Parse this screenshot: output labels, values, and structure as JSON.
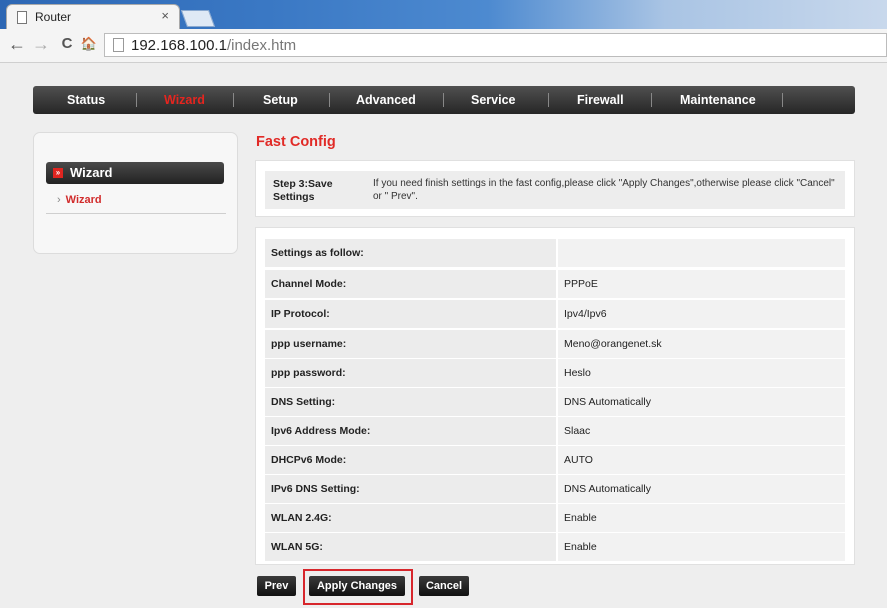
{
  "browser": {
    "tab_title": "Router",
    "tab_close": "×",
    "url_host": "192.168.100.1",
    "url_path": "/index.htm",
    "back_glyph": "←",
    "forward_glyph": "→",
    "reload_glyph": "C",
    "home_glyph": "🏠"
  },
  "nav": {
    "items": [
      {
        "label": "Status"
      },
      {
        "label": "Wizard",
        "active": true
      },
      {
        "label": "Setup"
      },
      {
        "label": "Advanced"
      },
      {
        "label": "Service"
      },
      {
        "label": "Firewall"
      },
      {
        "label": "Maintenance"
      }
    ]
  },
  "sidebar": {
    "header_mark": "»",
    "header_label": "Wizard",
    "chevron": "›",
    "item_label": "Wizard"
  },
  "page": {
    "title": "Fast Config",
    "step_label": "Step 3:Save Settings",
    "step_text": "If you need finish settings in the fast config,please click \"Apply Changes\",otherwise please click \"Cancel\" or \" Prev\"."
  },
  "settings": {
    "header": "Settings as follow:",
    "rows": [
      {
        "label": "Channel Mode:",
        "value": "PPPoE"
      },
      {
        "label": "IP Protocol:",
        "value": "Ipv4/Ipv6"
      },
      {
        "label": "ppp username:",
        "value": "Meno@orangenet.sk"
      },
      {
        "label": "ppp password:",
        "value": "Heslo"
      },
      {
        "label": "DNS Setting:",
        "value": "DNS Automatically"
      },
      {
        "label": "Ipv6 Address Mode:",
        "value": "Slaac"
      },
      {
        "label": "DHCPv6 Mode:",
        "value": "AUTO"
      },
      {
        "label": "IPv6 DNS Setting:",
        "value": "DNS Automatically"
      },
      {
        "label": "WLAN 2.4G:",
        "value": "Enable"
      },
      {
        "label": "WLAN 5G:",
        "value": "Enable"
      }
    ]
  },
  "buttons": {
    "prev": "Prev",
    "apply": "Apply Changes",
    "cancel": "Cancel"
  },
  "colors": {
    "accent_red": "#e12a26",
    "nav_dark": "#262626",
    "highlight_border": "#d7262c"
  }
}
